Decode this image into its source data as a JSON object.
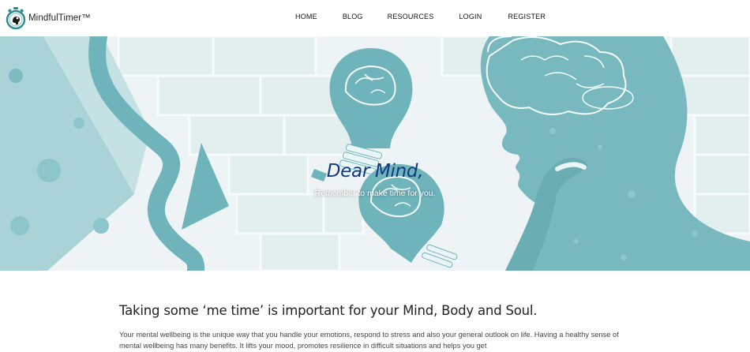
{
  "brand": {
    "name": "MindfulTimer™"
  },
  "nav": {
    "items": [
      {
        "label": "HOME"
      },
      {
        "label": "BLOG"
      },
      {
        "label": "RESOURCES"
      },
      {
        "label": "LOGIN"
      },
      {
        "label": "REGISTER"
      }
    ]
  },
  "hero": {
    "title": "Dear Mind,",
    "subtitle": "Remember to make time for you."
  },
  "content": {
    "heading": "Taking some ‘me time’ is important for your Mind, Body and Soul.",
    "paragraph": "Your mental wellbeing is the unique way that you handle your emotions, respond to stress and also your general outlook on life. Having a healthy sense of mental wellbeing has many benefits. It lifts your mood, promotes resilience in difficult situations and helps you get"
  },
  "colors": {
    "teal": "#6fb4bb",
    "teal_light": "#a9d3d7",
    "hero_bg": "#eef4f5",
    "title_blue": "#0e3a82"
  },
  "icons": {
    "logo": "stopwatch-brain-icon"
  }
}
